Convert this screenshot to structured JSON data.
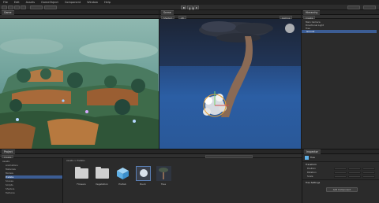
{
  "menu": [
    "File",
    "Edit",
    "Assets",
    "GameObject",
    "Component",
    "Window",
    "Help"
  ],
  "toolbar": {
    "pivot_label": "Pivot",
    "global_label": "Global",
    "layout_label": "Layout"
  },
  "game_tab": {
    "label": "Game"
  },
  "scene_tab": {
    "label": "Scene"
  },
  "scene_toolbar": {
    "shaded": "Shaded",
    "mode": "2D",
    "gizmos": "Gizmos"
  },
  "hierarchy": {
    "tab": "Hierarchy",
    "create": "Create",
    "items": [
      "Main Camera",
      "Directional Light",
      "Tree",
      "Ground"
    ]
  },
  "project": {
    "tab": "Project",
    "create": "Create",
    "breadcrumb": "Assets > Prefabs",
    "tree": [
      "Assets",
      "Animations",
      "Materials",
      "Models",
      "Prefabs",
      "Scenes",
      "Scripts",
      "Shaders",
      "Textures"
    ],
    "assets": [
      {
        "name": "Flowers",
        "kind": "folder"
      },
      {
        "name": "Vegetation",
        "kind": "folder"
      },
      {
        "name": "Prefab",
        "kind": "cube"
      },
      {
        "name": "Bush",
        "kind": "prefab"
      },
      {
        "name": "Tree",
        "kind": "tree"
      }
    ]
  },
  "inspector": {
    "tab": "Inspector",
    "object_name": "Tree",
    "component": "Transform",
    "rows": [
      "Position",
      "Rotation",
      "Scale"
    ],
    "component2": "Tree Settings",
    "add_component": "Add Component"
  },
  "colors": {
    "selection": "#3c5d94",
    "panel": "#2b2b2b",
    "sky": "#2c60a0"
  }
}
